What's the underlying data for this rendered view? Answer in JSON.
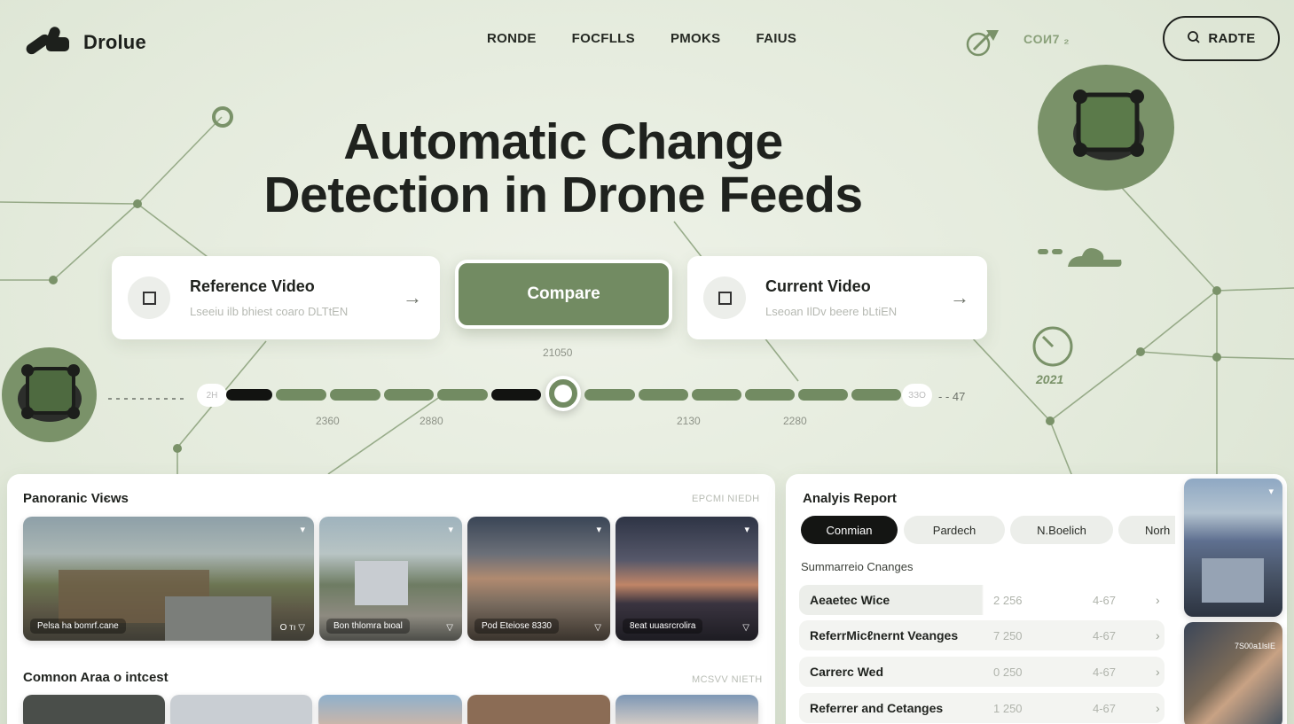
{
  "brand": {
    "name": "Drolue"
  },
  "nav": {
    "items": [
      "RONDE",
      "FOCFLLS",
      "PMOKS",
      "FAIUS"
    ]
  },
  "header": {
    "right_text": "COИ7 ₂",
    "cta_label": "RADTE"
  },
  "hero": {
    "line1": "Automatic Change",
    "line2": "Detection in Drone Feeds"
  },
  "inputs": {
    "reference": {
      "title": "Reference Video",
      "subtitle": "Lseeiu ilb bhiest coaro DLTtEN"
    },
    "compare": {
      "label": "Compare"
    },
    "current": {
      "title": "Current Video",
      "subtitle": "Lseoan IlDv beere bLtiEN"
    }
  },
  "timeline": {
    "top_label": "21050",
    "start_cap": "2H",
    "end_cap": "ЗЗО",
    "end_text": "- - 47",
    "ticks": [
      "2360",
      "2880",
      "2130",
      "2280"
    ],
    "year_label": "2021"
  },
  "panoramic": {
    "title": "Panoranic Viєws",
    "link": "EPCMI NIEDH",
    "thumbs": [
      {
        "caption": "Pelsa ha bomrf.cane",
        "corner_right": "O тı  ▽"
      },
      {
        "caption": "Bon thlomra bιoal",
        "corner_right": "▽"
      },
      {
        "caption": "Pod Eteiose 8330",
        "corner_right": "▽"
      },
      {
        "caption": "8eat uuasrcrolira",
        "corner_right": "▽"
      }
    ]
  },
  "common_area": {
    "title": "Comnon Araa o intcest",
    "link": "MCSVV NIETH"
  },
  "analysis": {
    "title": "Analyis Report",
    "tabs": [
      "Conmian",
      "Pardech",
      "N.Boelich",
      "Norh"
    ],
    "section": "Summarreio Cnanges",
    "rows": [
      {
        "label": "Aeaetec Wice",
        "v1": "2 256",
        "v2": "4-67"
      },
      {
        "label": "ReferrMicℓnernt Veanges",
        "v1": "7 250",
        "v2": "4-67"
      },
      {
        "label": "Carrerc Wed",
        "v1": "0 250",
        "v2": "4-67"
      },
      {
        "label": "Referrer and Cetanges",
        "v1": "1 250",
        "v2": "4-67"
      }
    ]
  },
  "side_thumb_label": "7S00a1lsIE",
  "colors": {
    "accent": "#728b62",
    "background": "#e3eadb",
    "dark": "#121311"
  }
}
